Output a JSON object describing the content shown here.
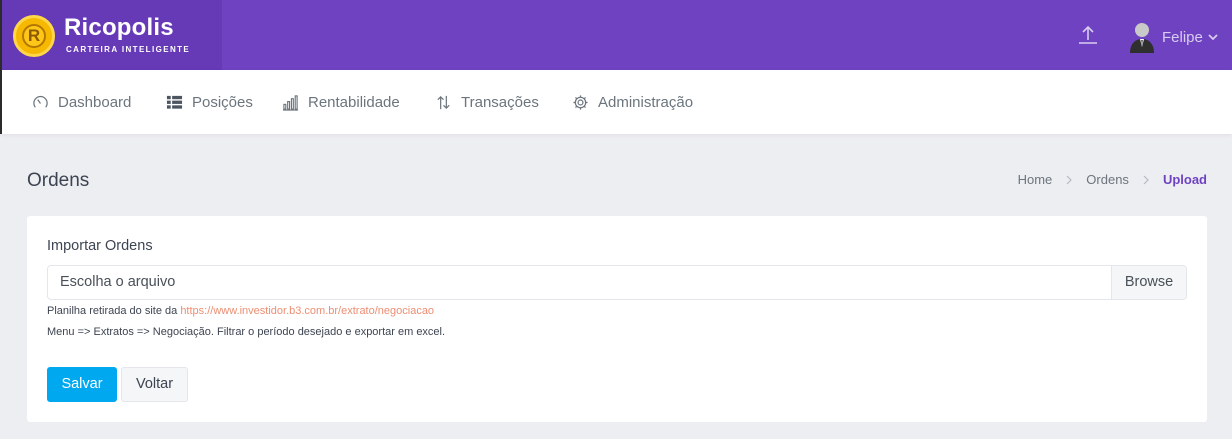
{
  "brand": {
    "name": "Ricopolis",
    "tagline": "CARTEIRA INTELIGENTE",
    "logo_letter": "R"
  },
  "header": {
    "user_name": "Felipe"
  },
  "nav": [
    {
      "label": "Dashboard",
      "icon": "gauge-icon"
    },
    {
      "label": "Posições",
      "icon": "list-icon"
    },
    {
      "label": "Rentabilidade",
      "icon": "bar-chart-icon"
    },
    {
      "label": "Transações",
      "icon": "transfer-arrows-icon"
    },
    {
      "label": "Administração",
      "icon": "gear-icon"
    }
  ],
  "page": {
    "title": "Ordens",
    "breadcrumb": [
      "Home",
      "Ordens",
      "Upload"
    ]
  },
  "form": {
    "label": "Importar Ordens",
    "file_placeholder": "Escolha o arquivo",
    "browse_label": "Browse",
    "help_prefix": "Planilha retirada do site da ",
    "help_link": "https://www.investidor.b3.com.br/extrato/negociacao",
    "help_line2": "Menu => Extratos => Negociação. Filtrar o período desejado e exportar em excel.",
    "save_label": "Salvar",
    "back_label": "Voltar"
  },
  "colors": {
    "primary": "#6f42c1",
    "brand_bg": "#6639b7",
    "save_button": "#00a8f0",
    "link": "#ec8e72",
    "page_bg": "#edeef2"
  }
}
